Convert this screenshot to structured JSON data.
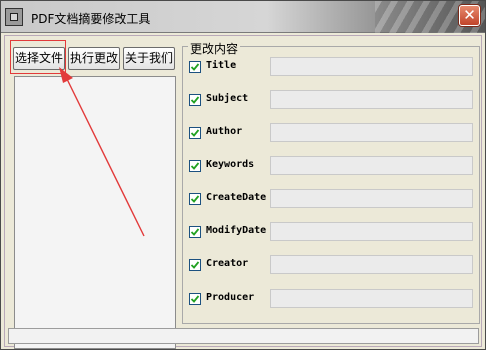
{
  "window": {
    "title": "PDF文档摘要修改工具",
    "close_glyph": "✕"
  },
  "toolbar": {
    "select_file": "选择文件",
    "execute": "执行更改",
    "about": "关于我们"
  },
  "group": {
    "title": "更改内容",
    "fields": [
      {
        "label": "Title",
        "checked": true,
        "value": ""
      },
      {
        "label": "Subject",
        "checked": true,
        "value": ""
      },
      {
        "label": "Author",
        "checked": true,
        "value": ""
      },
      {
        "label": "Keywords",
        "checked": true,
        "value": ""
      },
      {
        "label": "CreateDate",
        "checked": true,
        "value": ""
      },
      {
        "label": "ModifyDate",
        "checked": true,
        "value": ""
      },
      {
        "label": "Creator",
        "checked": true,
        "value": ""
      },
      {
        "label": "Producer",
        "checked": true,
        "value": ""
      }
    ]
  },
  "status": {
    "text": ""
  },
  "colors": {
    "annotation": "#e23a3a",
    "checkbox_border": "#1c5180",
    "checkmark": "#21a121"
  },
  "icons": {
    "app": "app-window-icon",
    "close": "close-icon",
    "check": "checkmark-icon"
  }
}
